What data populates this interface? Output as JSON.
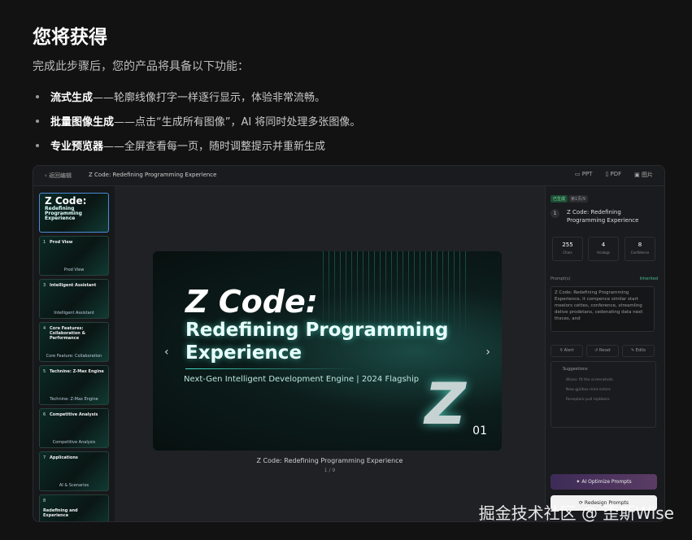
{
  "heading": "您将获得",
  "intro": "完成此步骤后，您的产品将具备以下功能：",
  "features": [
    {
      "bold": "流式生成",
      "rest": "——轮廓线像打字一样逐行显示，体验非常流畅。"
    },
    {
      "bold": "批量图像生成",
      "rest": "——点击“生成所有图像”，AI 将同时处理多张图像。"
    },
    {
      "bold": "专业预览器",
      "rest": "——全屏查看每一页，随时调整提示并重新生成"
    }
  ],
  "app": {
    "back_label": "返回编辑",
    "doc_title": "Z Code: Redefining Programming Experience",
    "exports": [
      "PPT",
      "PDF",
      "图片"
    ],
    "thumbnails": [
      {
        "num": "",
        "title": "Z Code:",
        "subtitle": "Redefining Programming Experience",
        "caption": ""
      },
      {
        "num": "1",
        "title": "Prod View",
        "caption": "Prod View"
      },
      {
        "num": "3",
        "title": "Intelligent Assistant",
        "caption": "Intelligent Assistant"
      },
      {
        "num": "4",
        "title": "Core Features: Collaboration & Performance",
        "caption": "Core Feature: Collaboration"
      },
      {
        "num": "5",
        "title": "Technine: Z-Max Engine",
        "caption": "Technine: Z-Max Engine"
      },
      {
        "num": "6",
        "title": "Competitive Analysis",
        "caption": "Competitive Analysis"
      },
      {
        "num": "7",
        "title": "Applications",
        "caption": "AI & Scenarios"
      },
      {
        "num": "8",
        "title": "Redefining and Experience",
        "caption": ""
      }
    ],
    "slide": {
      "title_line1": "Z Code:",
      "title_line2": "Redefining Programming",
      "title_line3": "Experience",
      "subtitle": "Next-Gen Intelligent Development Engine | 2024 Flagship",
      "page": "01",
      "logo": "Z"
    },
    "caption": "Z Code: Redefining Programming Experience",
    "pager": "1 / 9",
    "panel": {
      "badge_a": "已生成",
      "badge_b": "第1页/9",
      "num": "1",
      "title": "Z Code: Redefining Programming Experience",
      "stats": [
        {
          "value": "255",
          "label": "Chars"
        },
        {
          "value": "4",
          "label": "Analogs"
        },
        {
          "value": "8",
          "label": "Confidence"
        }
      ],
      "prompt_label": "Prompt(s)",
      "prompt_link": "Inherited",
      "prompt_text": "Z Code: Redefining Programming Experience, it compence similar start meelors cettes, conference, streamling delive prodetans, cedenating data next thsces, and",
      "buttons": [
        "Alert",
        "Reset",
        "Edits"
      ],
      "suggestions_title": "Suggestions",
      "suggestions": [
        "Wisso: fit the screenshots",
        "New gpl/bas mint ectors",
        "Reneplare pull mpbbers"
      ],
      "optimize": "✦ AI Optimize Prompts",
      "regenerate": "⟳ Redesign Prompts"
    }
  },
  "watermark": "掘金技术社区 @ 歪斯Wise"
}
